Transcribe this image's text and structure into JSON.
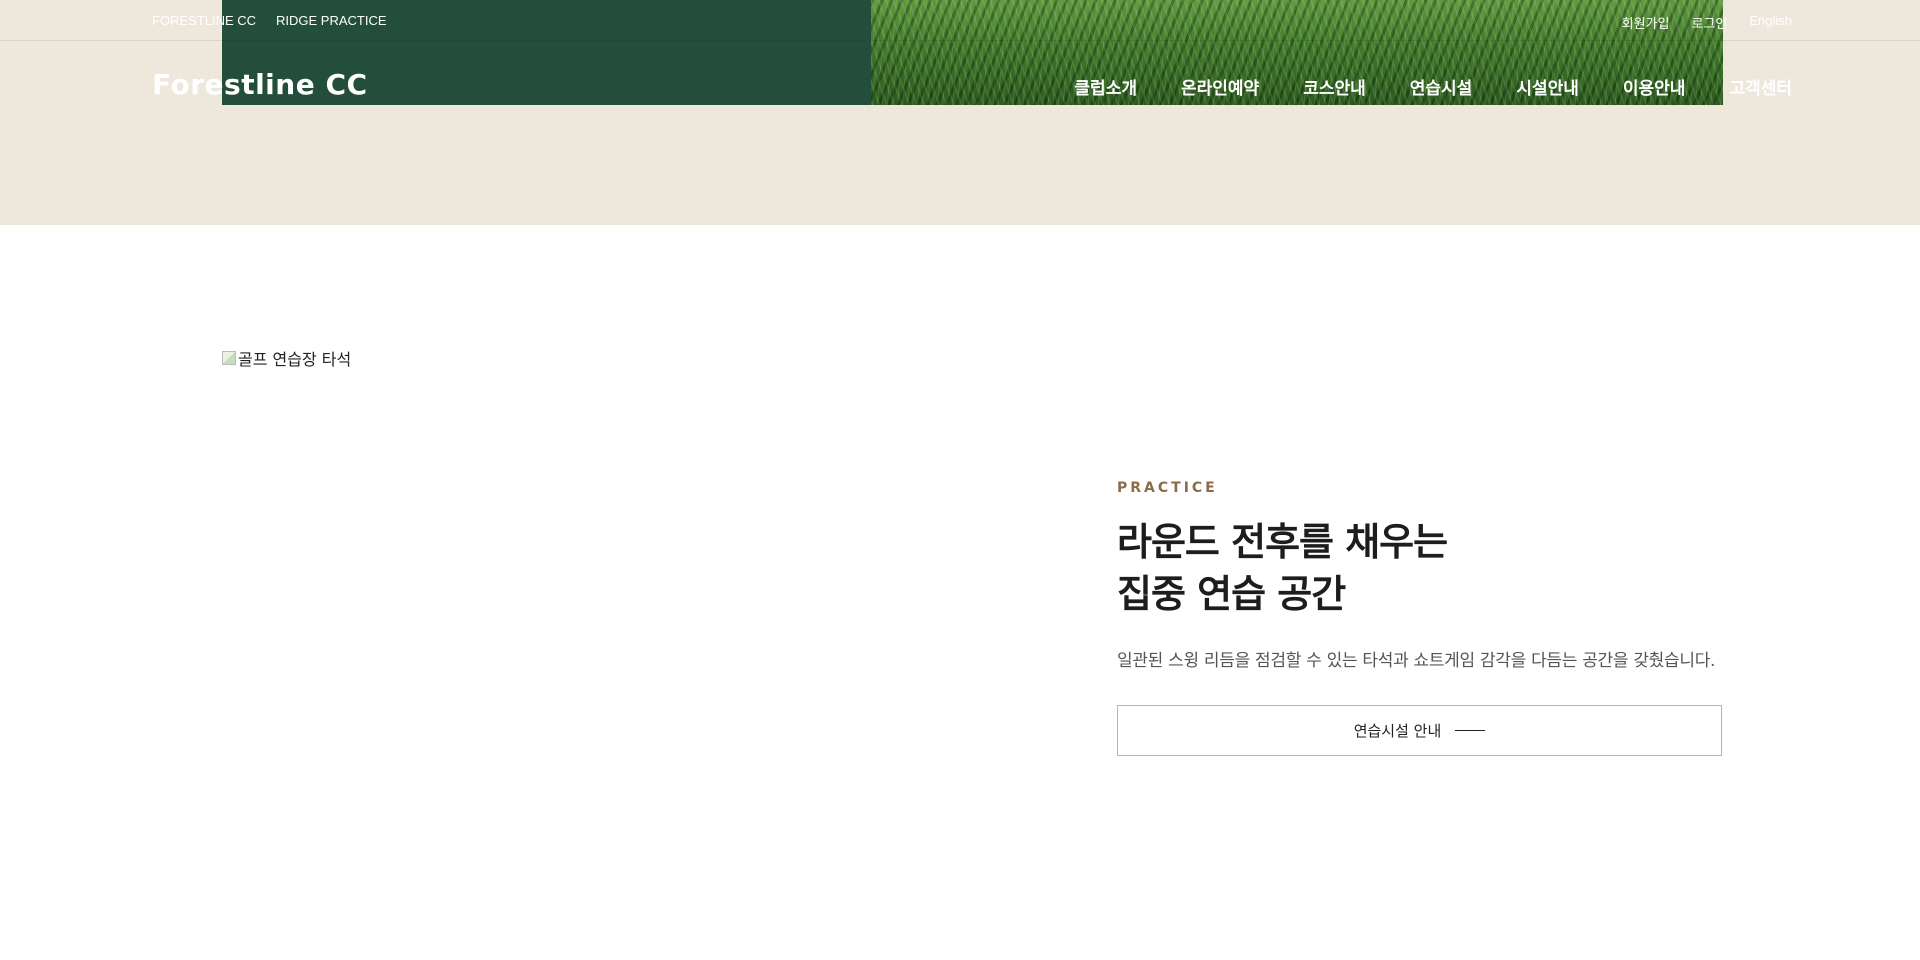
{
  "topbar": {
    "left_links": [
      "FORESTLINE CC",
      "RIDGE PRACTICE"
    ],
    "right_links": [
      "회원가입",
      "로그인",
      "English"
    ]
  },
  "header": {
    "logo": "Forestline CC",
    "nav": [
      "클럽소개",
      "온라인예약",
      "코스안내",
      "연습시설",
      "시설안내",
      "이용안내",
      "고객센터"
    ]
  },
  "content": {
    "image_alt": "골프 연습장 타석",
    "eyebrow": "PRACTICE",
    "heading_line1": "라운드 전후를 채우는",
    "heading_line2": "집중 연습 공간",
    "description": "일관된 스윙 리듬을 점검할 수 있는 타석과 쇼트게임 감각을 다듬는 공간을 갖췄습니다.",
    "cta_label": "연습시설 안내"
  },
  "colors": {
    "header_bg": "#ede7dc",
    "green_panel": "#234e3c",
    "eyebrow": "#8b6b48"
  },
  "icons": {
    "broken_image": "broken-image-icon",
    "cta_arrow": "arrow-line-icon"
  }
}
